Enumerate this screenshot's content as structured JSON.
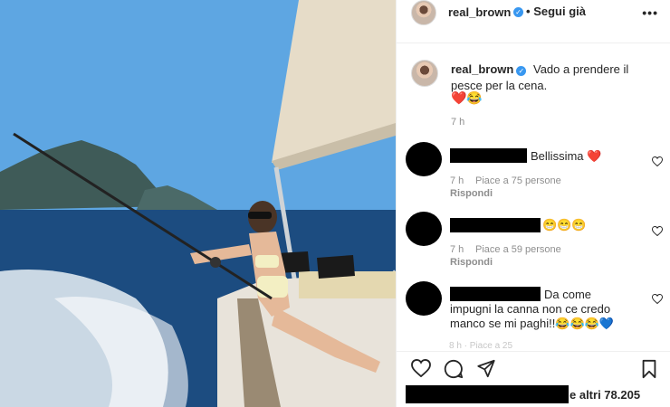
{
  "post": {
    "username": "real_brown",
    "follow_label": "Segui già",
    "more_label": "•••",
    "caption_text": "Vado a prendere il pesce per la cena.",
    "caption_emojis": "❤️😂",
    "caption_time": "7 h"
  },
  "comments": [
    {
      "text": "Bellissima ❤️",
      "time": "7 h",
      "likes": "Piace a 75 persone",
      "reply": "Rispondi"
    },
    {
      "text": "😁😁😁",
      "time": "7 h",
      "likes": "Piace a 59 persone",
      "reply": "Rispondi"
    },
    {
      "text_line1": "Da come",
      "text_line2": "impugni la canna non ce credo",
      "text_line3": "manco se mi paghi!!😂😂😂💙",
      "partial_meta": "8 h · Piace a 25"
    }
  ],
  "likes_summary": "e altri 78.205",
  "icons": {
    "verified": "verified-badge-icon",
    "heart": "heart-icon",
    "comment": "comment-icon",
    "share": "share-icon",
    "bookmark": "bookmark-icon",
    "more": "more-icon"
  },
  "colors": {
    "verified_blue": "#3897f0",
    "secondary_text": "#8e8e8e",
    "divider": "#efefef"
  }
}
